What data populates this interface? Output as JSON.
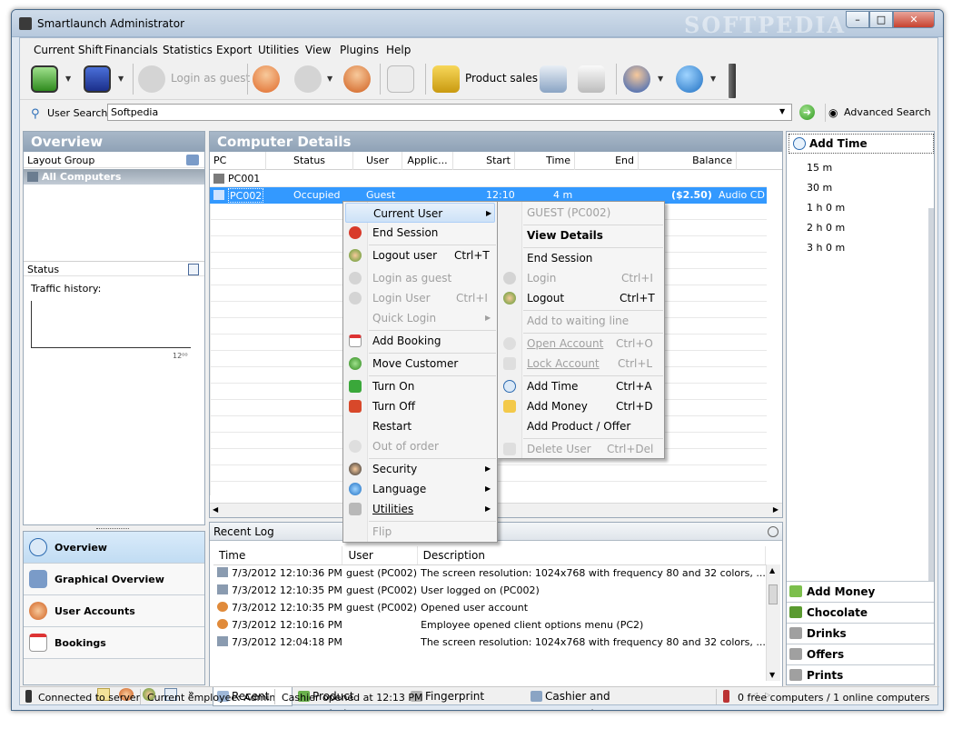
{
  "window": {
    "title": "Smartlaunch Administrator",
    "watermark": "SOFTPEDIA"
  },
  "menu": [
    "Current Shift",
    "Financials",
    "Statistics",
    "Export",
    "Utilities",
    "View",
    "Plugins",
    "Help"
  ],
  "toolbar": {
    "login_guest": "Login as guest",
    "product_sales": "Product sales"
  },
  "search": {
    "label": "User Search:",
    "value": "Softpedia",
    "advanced": "Advanced Search"
  },
  "overview": {
    "title": "Overview",
    "layout_group": "Layout Group",
    "all_computers": "All Computers",
    "status": "Status",
    "traffic": "Traffic history:",
    "axis_tick": "12⁰⁰"
  },
  "nav": [
    {
      "label": "Overview"
    },
    {
      "label": "Graphical Overview"
    },
    {
      "label": "User Accounts"
    },
    {
      "label": "Bookings"
    }
  ],
  "details": {
    "title": "Computer Details",
    "columns": [
      "PC",
      "Status",
      "User",
      "Applic...",
      "Start",
      "Time",
      "End",
      "Balance"
    ],
    "rows": [
      {
        "pc": "PC001",
        "status": "",
        "user": "",
        "app": "",
        "start": "",
        "time": "",
        "end": "",
        "balance": "",
        "extra": ""
      },
      {
        "pc": "PC002",
        "status": "Occupied",
        "user": "Guest",
        "app": "",
        "start": "12:10",
        "time": "4 m",
        "end": "",
        "balance": "($2.50)",
        "extra": "Audio CD"
      }
    ]
  },
  "recent_log": {
    "title": "Recent Log",
    "columns": [
      "Time",
      "User",
      "Description"
    ],
    "rows": [
      {
        "time": "7/3/2012 12:10:36 PM",
        "user": "guest (PC002)",
        "desc": "The screen resolution: 1024x768 with frequency 80 and 32 colors, ..."
      },
      {
        "time": "7/3/2012 12:10:35 PM",
        "user": "guest (PC002)",
        "desc": "User logged on (PC002)"
      },
      {
        "time": "7/3/2012 12:10:35 PM",
        "user": "guest (PC002)",
        "desc": "Opened user account"
      },
      {
        "time": "7/3/2012 12:10:16 PM",
        "user": "",
        "desc": "Employee opened client options menu (PC2)"
      },
      {
        "time": "7/3/2012 12:04:18 PM",
        "user": "",
        "desc": "The screen resolution: 1024x768 with frequency 80 and 32 colors, ..."
      }
    ]
  },
  "tabs": [
    "Recent Log",
    "Product Ordering",
    "Fingerprint scanner",
    "Cashier and Transactions"
  ],
  "add_time": {
    "title": "Add Time",
    "items": [
      "15 m",
      "30 m",
      "1 h 0 m",
      "2 h 0 m",
      "3 h 0 m"
    ]
  },
  "products": [
    "Add Money",
    "Chocolate",
    "Drinks",
    "Offers",
    "Prints"
  ],
  "status": {
    "connected": "Connected to server",
    "employee": "Current employee: Admin",
    "cashier": "Cashier opened at 12:13 PM",
    "computers": "0 free computers / 1 online computers"
  },
  "context_menu": {
    "current_user": "Current User",
    "end_session": "End Session",
    "logout_user": "Logout user",
    "logout_user_sc": "Ctrl+T",
    "login_guest": "Login as guest",
    "login_user": "Login User",
    "login_user_sc": "Ctrl+I",
    "quick_login": "Quick Login",
    "add_booking": "Add Booking",
    "move_customer": "Move Customer",
    "turn_on": "Turn On",
    "turn_off": "Turn Off",
    "restart": "Restart",
    "out_of_order": "Out of order",
    "security": "Security",
    "language": "Language",
    "utilities": "Utilities",
    "flip": "Flip"
  },
  "submenu": {
    "header": "GUEST (PC002)",
    "view_details": "View Details",
    "end_session": "End Session",
    "login": "Login",
    "login_sc": "Ctrl+I",
    "logout": "Logout",
    "logout_sc": "Ctrl+T",
    "waiting": "Add to waiting line",
    "open_account": "Open Account",
    "open_account_sc": "Ctrl+O",
    "lock_account": "Lock Account",
    "lock_account_sc": "Ctrl+L",
    "add_time": "Add Time",
    "add_time_sc": "Ctrl+A",
    "add_money": "Add Money",
    "add_money_sc": "Ctrl+D",
    "add_product": "Add Product / Offer",
    "delete_user": "Delete User",
    "delete_user_sc": "Ctrl+Del"
  },
  "colors": {
    "accent": "#3399ff",
    "panel_header": "#9aabbe",
    "selection": "#cde2f7"
  }
}
